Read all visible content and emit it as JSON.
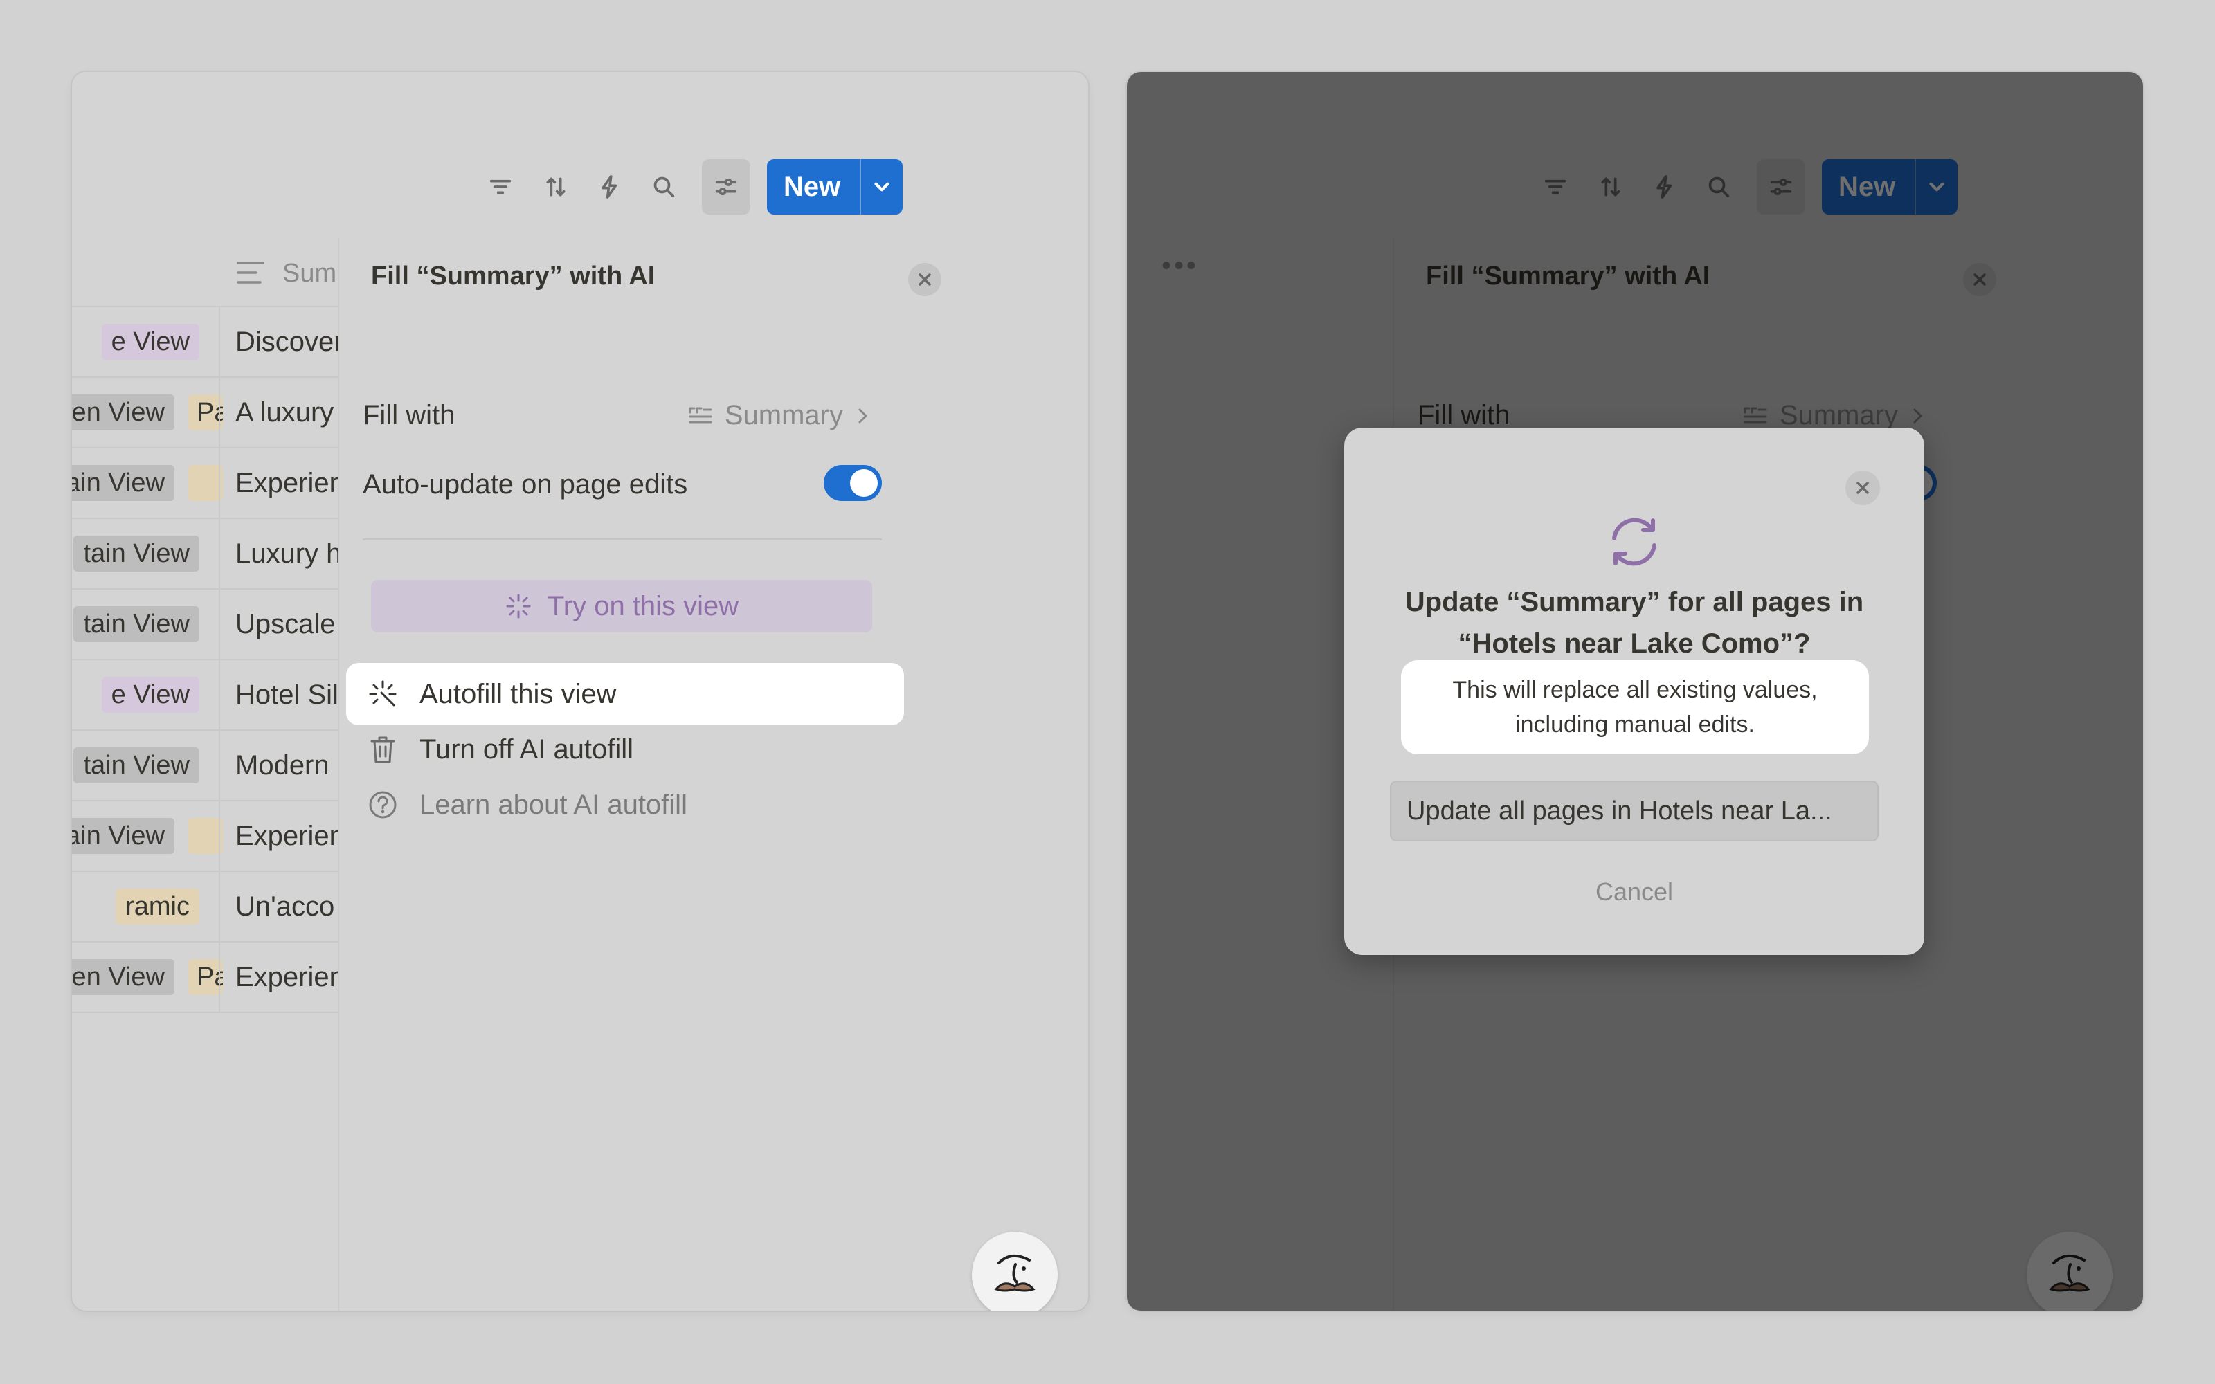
{
  "toolbar": {
    "icons": [
      "filter-icon",
      "sort-icon",
      "lightning-icon",
      "search-icon",
      "sliders-icon"
    ],
    "new_label": "New"
  },
  "table": {
    "column_header": "Summary",
    "rows": [
      {
        "tag": "e View",
        "tag_color": "purple",
        "summary": "Discover"
      },
      {
        "tag": "en View",
        "tag_color": "gray",
        "tag2": "Pa",
        "summary": "A luxury"
      },
      {
        "tag": "tain View",
        "tag_color": "gray",
        "tag2": "",
        "summary": "Experien"
      },
      {
        "tag": "tain View",
        "tag_color": "gray",
        "summary": "Luxury h"
      },
      {
        "tag": "tain View",
        "tag_color": "gray",
        "summary": "Upscale"
      },
      {
        "tag": "e View",
        "tag_color": "purple",
        "summary": "Hotel Sil"
      },
      {
        "tag": "tain View",
        "tag_color": "gray",
        "summary": "Modern"
      },
      {
        "tag": "tain View",
        "tag_color": "gray",
        "tag2": "",
        "summary": "Experien"
      },
      {
        "tag": "ramic",
        "tag_color": "yellow",
        "summary": "Un'acco"
      },
      {
        "tag": "en View",
        "tag_color": "gray",
        "tag2": "Pa",
        "summary": "Experien"
      }
    ]
  },
  "fill_panel": {
    "title": "Fill “Summary” with AI",
    "fill_with_label": "Fill with",
    "fill_with_value": "Summary",
    "auto_update_label": "Auto-update on page edits",
    "auto_update_on": true,
    "try_button": "Try on this view",
    "menu": {
      "autofill": "Autofill this view",
      "turn_off": "Turn off AI autofill",
      "learn": "Learn about AI autofill"
    }
  },
  "modal": {
    "title": "Update “Summary” for all pages in “Hotels near Lake Como”?",
    "description": "This will replace all existing values, including manual edits.",
    "primary_button": "Update all pages in Hotels near La...",
    "cancel_button": "Cancel"
  },
  "colors": {
    "accent_blue": "#1f6fd1",
    "ai_purple": "#8f6fa8",
    "background": "#d2d2d2"
  }
}
